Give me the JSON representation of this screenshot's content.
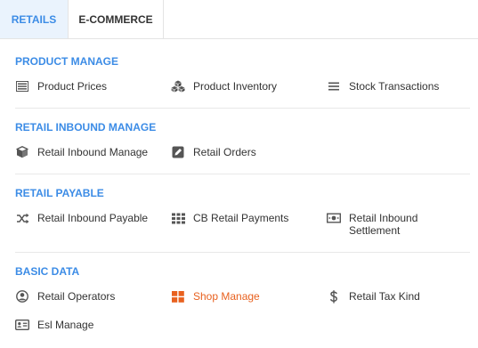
{
  "tabs": [
    {
      "label": "RETAILS",
      "active": true
    },
    {
      "label": "E-COMMERCE",
      "active": false
    }
  ],
  "accent_color": "#3c8ce6",
  "highlight_color": "#e8611f",
  "sections": [
    {
      "title": "PRODUCT MANAGE",
      "items": [
        {
          "label": "Product Prices",
          "icon": "price-list-icon"
        },
        {
          "label": "Product Inventory",
          "icon": "cubes-icon"
        },
        {
          "label": "Stock Transactions",
          "icon": "list-icon"
        }
      ]
    },
    {
      "title": "RETAIL INBOUND MANAGE",
      "items": [
        {
          "label": "Retail Inbound Manage",
          "icon": "box-icon"
        },
        {
          "label": "Retail Orders",
          "icon": "edit-icon"
        }
      ]
    },
    {
      "title": "RETAIL PAYABLE",
      "items": [
        {
          "label": "Retail Inbound Payable",
          "icon": "shuffle-icon"
        },
        {
          "label": "CB Retail Payments",
          "icon": "grid-icon"
        },
        {
          "label": "Retail Inbound",
          "label2": "Settlement",
          "icon": "money-bill-icon"
        }
      ]
    },
    {
      "title": "BASIC DATA",
      "items": [
        {
          "label": "Retail Operators",
          "icon": "user-circle-icon"
        },
        {
          "label": "Shop Manage",
          "icon": "shop-grid-icon",
          "highlight": true
        },
        {
          "label": "Retail Tax Kind",
          "icon": "dollar-icon"
        },
        {
          "label": "Esl Manage",
          "icon": "id-card-icon"
        }
      ]
    }
  ]
}
